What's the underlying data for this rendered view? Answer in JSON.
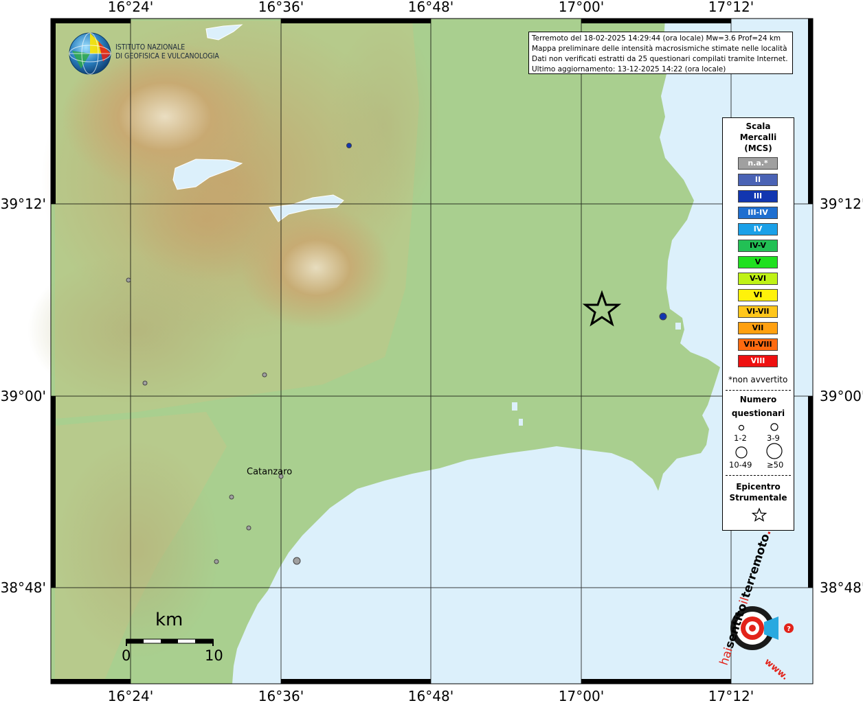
{
  "map": {
    "longitude_ticks": [
      "16°24'",
      "16°36'",
      "16°48'",
      "17°00'",
      "17°12'"
    ],
    "latitude_ticks": [
      "39°12'",
      "39°00'",
      "38°48'"
    ],
    "places": [
      {
        "name": "Catanzaro"
      }
    ],
    "epicenter_symbol": "star-icon"
  },
  "logo": {
    "line1": "ISTITUTO NAZIONALE",
    "line2": "DI GEOFISICA E VULCANOLOGIA",
    "icon": "globe-icon"
  },
  "info": {
    "line1": "Terremoto del 18-02-2025 14:29:44 (ora locale) Mw=3.6 Prof=24 km",
    "line2": "Mappa preliminare delle intensità macrosismiche stimate nelle località",
    "line3": "Dati non verificati estratti da 25 questionari compilati tramite Internet.",
    "line4": "Ultimo aggiornamento: 13-12-2025 14:22 (ora locale)"
  },
  "legend": {
    "title1": "Scala",
    "title2": "Mercalli",
    "title3": "(MCS)",
    "scale": [
      {
        "label": "n.a.*",
        "color": "#a0a0a0",
        "text": "#ffffff"
      },
      {
        "label": "II",
        "color": "#4a63b5",
        "text": "#ffffff"
      },
      {
        "label": "III",
        "color": "#1236b0",
        "text": "#ffffff"
      },
      {
        "label": "III-IV",
        "color": "#1f6fd0",
        "text": "#ffffff"
      },
      {
        "label": "IV",
        "color": "#1aa0e8",
        "text": "#ffffff"
      },
      {
        "label": "IV-V",
        "color": "#22c055",
        "text": "#000000"
      },
      {
        "label": "V",
        "color": "#1fe01f",
        "text": "#000000"
      },
      {
        "label": "V-VI",
        "color": "#bff216",
        "text": "#000000"
      },
      {
        "label": "VI",
        "color": "#fff20a",
        "text": "#000000"
      },
      {
        "label": "VI-VII",
        "color": "#ffc61a",
        "text": "#000000"
      },
      {
        "label": "VII",
        "color": "#ffa010",
        "text": "#000000"
      },
      {
        "label": "VII-VIII",
        "color": "#ff6a10",
        "text": "#000000"
      },
      {
        "label": "VIII",
        "color": "#ee1010",
        "text": "#ffffff"
      }
    ],
    "note": "*non avvertito",
    "count_title1": "Numero",
    "count_title2": "questionari",
    "counts": [
      "1-2",
      "3-9",
      "10-49",
      "≥50"
    ],
    "epi_title1": "Epicentro",
    "epi_title2": "Strumentale"
  },
  "scale_bar": {
    "unit": "km",
    "start": "0",
    "end": "10"
  },
  "brand": {
    "text1": "hai",
    "text2": "sentito",
    "text3": "il",
    "text4": "terremoto",
    "text5": ".it",
    "text6": "www.",
    "icon": "target-icon"
  }
}
